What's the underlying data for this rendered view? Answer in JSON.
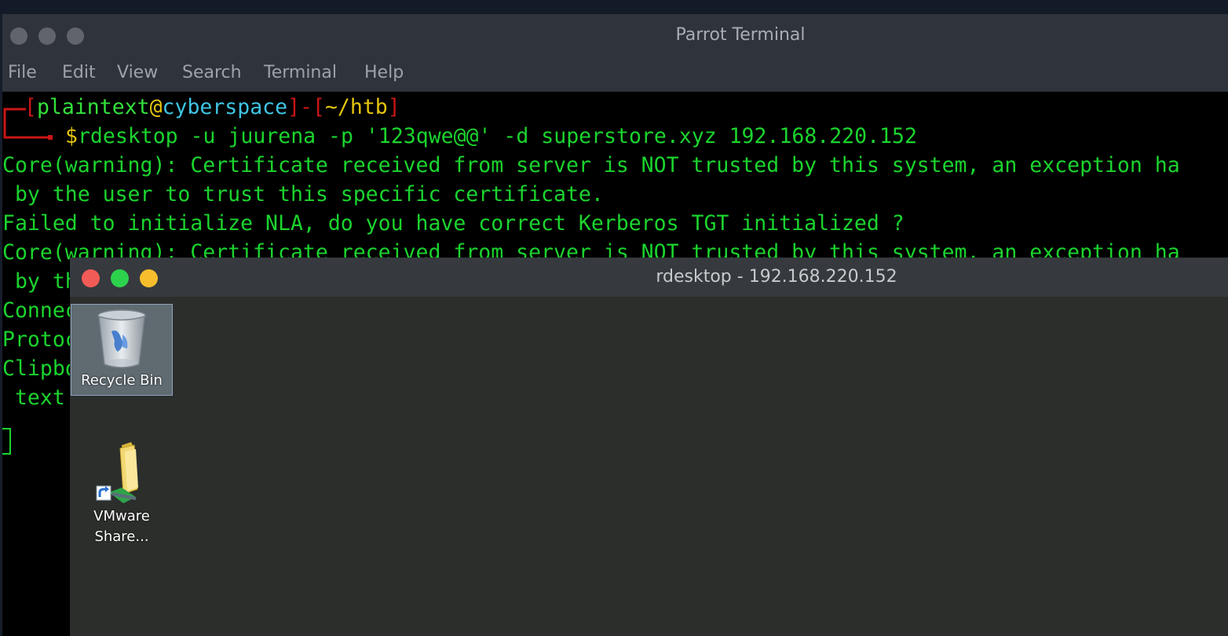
{
  "terminal": {
    "title": "Parrot Terminal",
    "menu": [
      "File",
      "Edit",
      "View",
      "Search",
      "Terminal",
      "Help"
    ],
    "prompt": {
      "user": "plaintext",
      "at": "@",
      "host": "cyberspace",
      "dir": "~/htb",
      "symbol": "$",
      "command": "rdesktop -u juurena -p '123qwe@@' -d superstore.xyz 192.168.220.152"
    },
    "output_lines": [
      "Core(warning): Certificate received from server is NOT trusted by this system, an exception ha",
      " by the user to trust this specific certificate.",
      "Failed to initialize NLA, do you have correct Kerberos TGT initialized ?",
      "Core(warning): Certificate received from server is NOT trusted by this system, an exception ha",
      " by th",
      "Connec",
      "Protoc",
      "Clipbo",
      " text"
    ]
  },
  "rdesktop": {
    "title": "rdesktop - 192.168.220.152",
    "icons": [
      {
        "label": "Recycle Bin",
        "icon": "recycle-bin-icon"
      },
      {
        "label_line1": "VMware",
        "label_line2": "Share...",
        "icon": "shared-folder-shortcut-icon"
      }
    ]
  },
  "colors": {
    "terminal_green": "#1bd42e",
    "prompt_red": "#ca1616",
    "prompt_yellow": "#e5c50e",
    "prompt_cyan": "#3fc5e3",
    "close_red": "#f15b57",
    "maximize_green": "#2dd24c",
    "minimize_yellow": "#f6be2d"
  }
}
